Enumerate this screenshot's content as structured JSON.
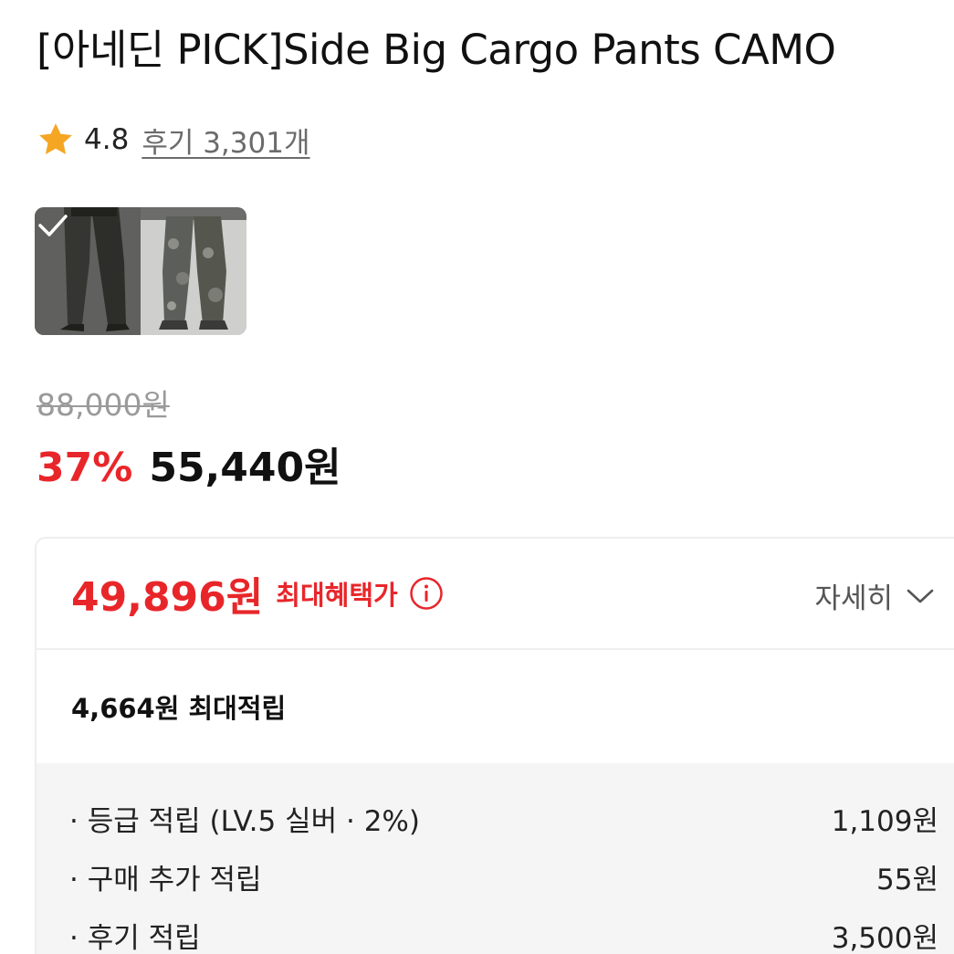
{
  "product": {
    "title": "[아네딘 PICK]Side Big Cargo Pants CAMO",
    "rating": "4.8",
    "review_link": "후기 3,301개",
    "thumbnails": [
      {
        "name": "thumb-black",
        "selected": true
      },
      {
        "name": "thumb-camo",
        "selected": false
      }
    ]
  },
  "price": {
    "original": "88,000원",
    "discount": "37%",
    "sale": "55,440원"
  },
  "benefit": {
    "best_price": "49,896원",
    "best_label": "최대혜택가",
    "detail_label": "자세히",
    "max_earn": "4,664원 최대적립",
    "items": [
      {
        "label": "· 등급 적립 (LV.5 실버 · 2%)",
        "amount": "1,109원"
      },
      {
        "label": "· 구매 추가 적립",
        "amount": "55원"
      },
      {
        "label": "· 후기 적립",
        "amount": "3,500원"
      }
    ]
  },
  "icons": {
    "star": "star-icon",
    "check": "check-icon",
    "info": "info-icon",
    "chevron": "chevron-down-icon"
  },
  "colors": {
    "accent_red": "#e8262a",
    "star": "#f5a623",
    "muted": "#9a9a9a",
    "panel_bg": "#f5f5f5"
  }
}
